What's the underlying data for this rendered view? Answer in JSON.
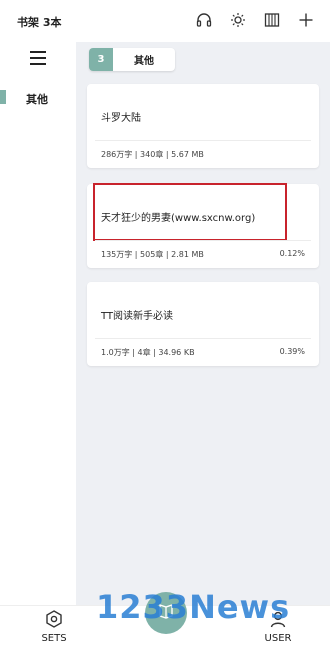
{
  "header": {
    "title": "书架 3本",
    "icons": [
      "headphones-icon",
      "brightness-icon",
      "grid-icon",
      "add-icon"
    ]
  },
  "sidebar": {
    "items": [
      {
        "label": "其他",
        "selected": true
      }
    ]
  },
  "tabs": [
    {
      "count": "3",
      "label": "其他"
    }
  ],
  "books": [
    {
      "title": "斗罗大陆",
      "meta": "286万字 | 340章 | 5.67 MB",
      "progress": ""
    },
    {
      "title": "天才狂少的男妻(www.sxcnw.org)",
      "meta": "135万字 | 505章 | 2.81 MB",
      "progress": "0.12%"
    },
    {
      "title": "TT阅读新手必读",
      "meta": "1.0万字 | 4章 | 34.96 KB",
      "progress": "0.39%"
    }
  ],
  "bottom_nav": {
    "sets_label": "SETS",
    "user_label": "USER"
  },
  "watermark": "1233News",
  "colors": {
    "accent": "#7fb2a8",
    "highlight": "#c8232c",
    "background": "#eef0f4"
  }
}
